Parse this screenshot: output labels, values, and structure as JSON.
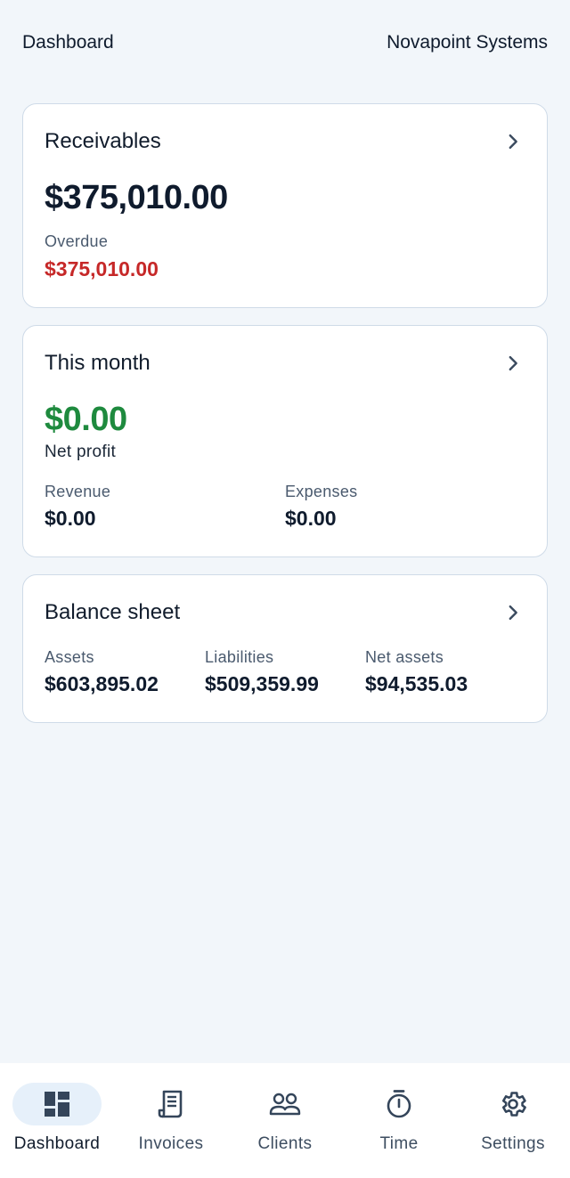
{
  "header": {
    "title": "Dashboard",
    "company": "Novapoint Systems"
  },
  "receivables": {
    "title": "Receivables",
    "amount": "$375,010.00",
    "overdue_label": "Overdue",
    "overdue_amount": "$375,010.00"
  },
  "this_month": {
    "title": "This month",
    "net_profit": "$0.00",
    "net_profit_label": "Net profit",
    "revenue_label": "Revenue",
    "revenue": "$0.00",
    "expenses_label": "Expenses",
    "expenses": "$0.00"
  },
  "balance_sheet": {
    "title": "Balance sheet",
    "assets_label": "Assets",
    "assets": "$603,895.02",
    "liabilities_label": "Liabilities",
    "liabilities": "$509,359.99",
    "net_assets_label": "Net assets",
    "net_assets": "$94,535.03"
  },
  "nav": {
    "items": [
      {
        "label": "Dashboard",
        "icon": "dashboard-icon",
        "active": true
      },
      {
        "label": "Invoices",
        "icon": "invoice-icon",
        "active": false
      },
      {
        "label": "Clients",
        "icon": "clients-icon",
        "active": false
      },
      {
        "label": "Time",
        "icon": "timer-icon",
        "active": false
      },
      {
        "label": "Settings",
        "icon": "gear-icon",
        "active": false
      }
    ]
  },
  "colors": {
    "overdue": "#c62828",
    "profit": "#1e8a3e",
    "accent_pill": "#e6f0fa"
  }
}
